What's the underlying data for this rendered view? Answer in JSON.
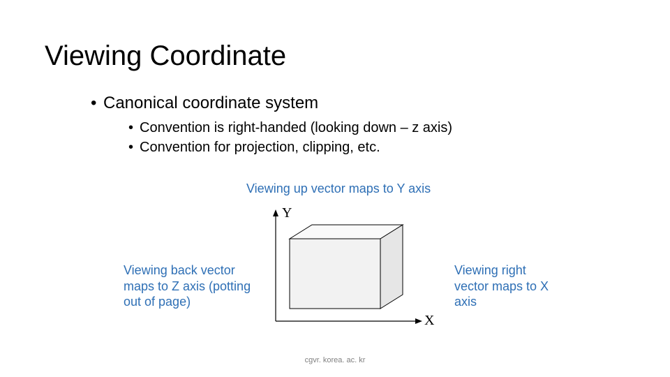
{
  "title": "Viewing Coordinate",
  "bullet1": "Canonical coordinate system",
  "bullet2a": "Convention is right-handed (looking down – z axis)",
  "bullet2b": "Convention for projection, clipping, etc.",
  "annotation_top": "Viewing up vector maps to Y axis",
  "annotation_left": "Viewing back vector maps to Z axis (potting out of page)",
  "annotation_right": "Viewing right vector maps to X axis",
  "y_label": "Y",
  "x_label": "X",
  "footer": "cgvr. korea. ac. kr"
}
